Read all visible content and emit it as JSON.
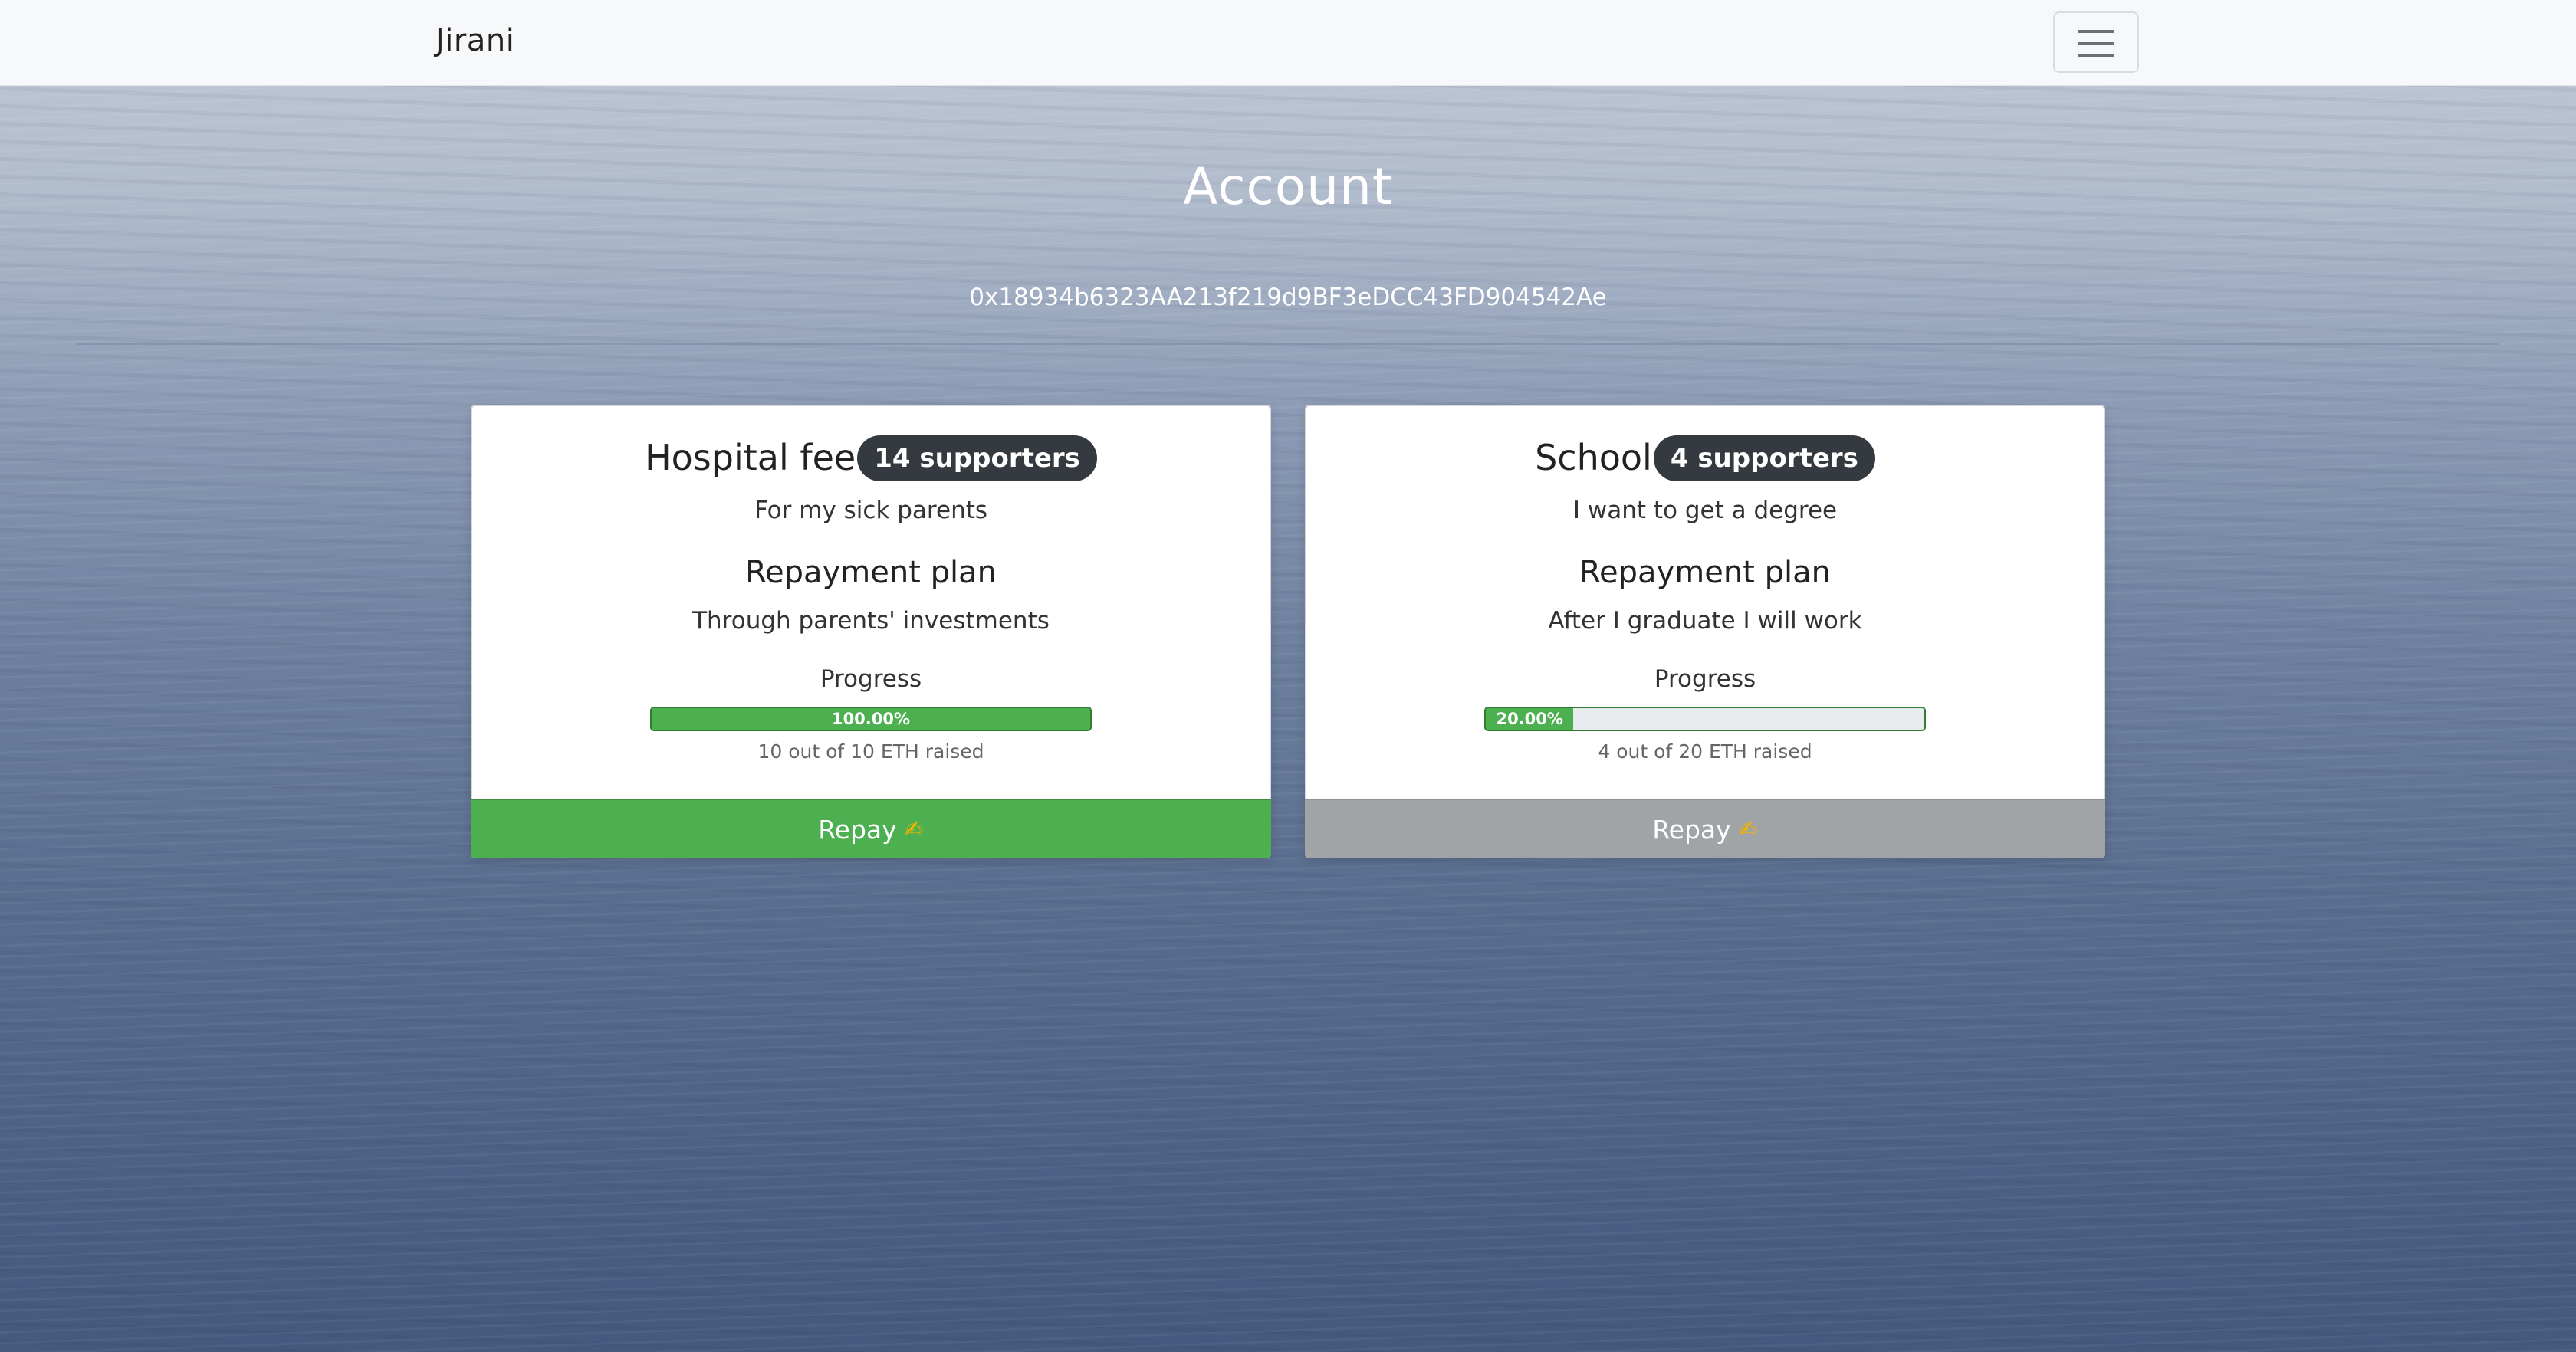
{
  "navbar": {
    "brand": "Jirani",
    "menu_icon": "hamburger-menu-icon"
  },
  "header": {
    "title": "Account",
    "address": "0x18934b6323AA213f219d9BF3eDCC43FD904542Ae"
  },
  "cards": [
    {
      "title": "Hospital fee",
      "supporters": "14 supporters",
      "description": "For my sick parents",
      "plan_heading": "Repayment plan",
      "plan": "Through parents' investments",
      "progress_heading": "Progress",
      "progress_value": 1.0,
      "progress_label": "100.00%",
      "raised": "10 out of 10 ETH raised",
      "button_label": "Repay",
      "button_icon": "writing-hand-icon",
      "button_color": "#4caf50"
    },
    {
      "title": "School",
      "supporters": "4 supporters",
      "description": "I want to get a degree",
      "plan_heading": "Repayment plan",
      "plan": "After I graduate I will work",
      "progress_heading": "Progress",
      "progress_value": 0.2,
      "progress_label": "20.00%",
      "raised": "4 out of 20 ETH raised",
      "button_label": "Repay",
      "button_icon": "writing-hand-icon",
      "button_color": "#a1a4a7"
    }
  ],
  "colors": {
    "progress": "#4caf50",
    "badge": "#343a40"
  }
}
